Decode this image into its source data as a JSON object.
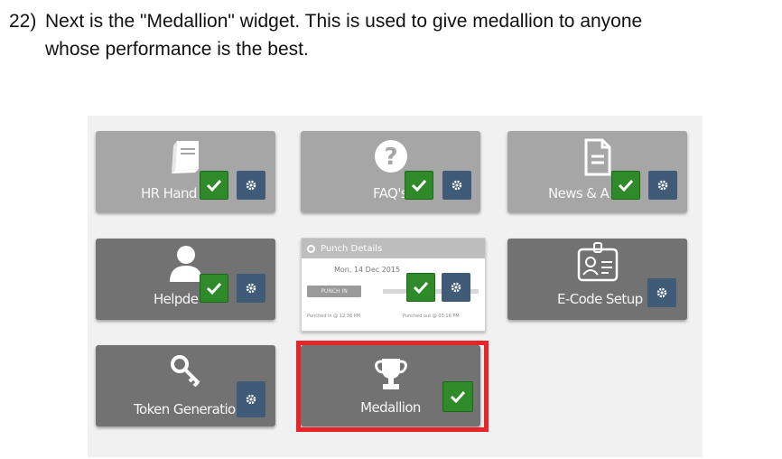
{
  "instruction": {
    "number": "22)",
    "line1": "Next is the \"Medallion\" widget. This is used to give medallion to anyone",
    "line2": "whose performance is the best."
  },
  "widgets": [
    {
      "label": "HR Hand",
      "icon": "book-icon",
      "checked": true,
      "has_settings": true
    },
    {
      "label": "FAQ's",
      "icon": "question-icon",
      "checked": true,
      "has_settings": true
    },
    {
      "label": "News & A",
      "icon": "document-icon",
      "checked": true,
      "has_settings": true
    },
    {
      "label": "Helpde",
      "icon": "user-icon",
      "checked": true,
      "has_settings": true
    },
    {
      "label": "Punch Details",
      "icon": "clock-icon",
      "checked": true,
      "has_settings": true
    },
    {
      "label": "E-Code Setup",
      "icon": "id-card-icon",
      "checked": false,
      "has_settings": true
    },
    {
      "label": "Token Generation",
      "icon": "key-icon",
      "checked": false,
      "has_settings": true
    },
    {
      "label": "Medallion",
      "icon": "trophy-icon",
      "checked": true,
      "has_settings": false
    }
  ],
  "punch": {
    "title": "Punch Details",
    "date": "Mon, 14 Dec 2015",
    "button": "PUNCH IN",
    "punched_in": "Punched in @ 12:36 PM",
    "punched_out": "Punched out @ 03:16 PM"
  },
  "colors": {
    "check": "#2f8a2a",
    "settings": "#3f5b78",
    "highlight": "#e8242a"
  }
}
